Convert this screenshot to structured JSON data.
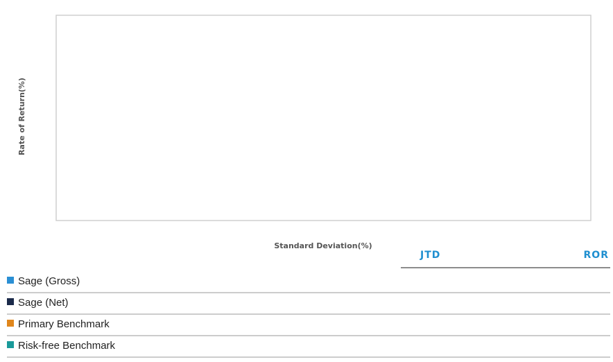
{
  "chart_data": {
    "type": "scatter",
    "title": "",
    "xlabel": "Standard Deviation(%)",
    "ylabel": "Rate of Return(%)",
    "grid": false,
    "legend_position": "bottom",
    "series": [
      {
        "name": "Sage (Gross)",
        "color": "#2a8fd4",
        "points": []
      },
      {
        "name": "Sage (Net)",
        "color": "#1b2a4a",
        "points": []
      },
      {
        "name": "Primary Benchmark",
        "color": "#e0861c",
        "points": []
      },
      {
        "name": "Risk-free Benchmark",
        "color": "#1a9a9a",
        "points": []
      }
    ]
  },
  "table_header": {
    "col1": "JTD",
    "col2": "ROR"
  }
}
